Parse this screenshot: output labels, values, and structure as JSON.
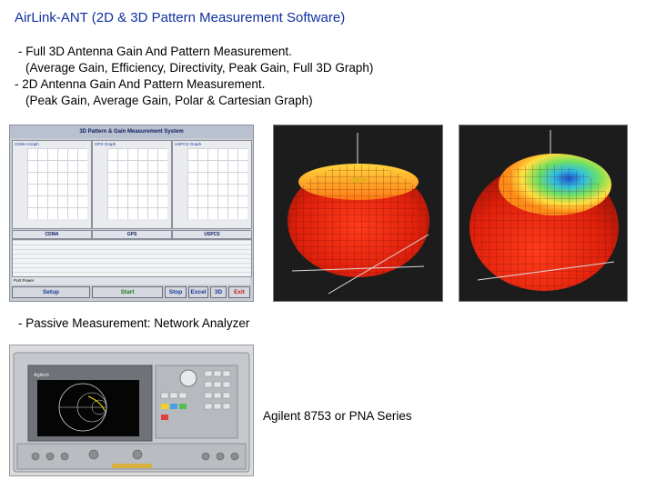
{
  "title": "AirLink-ANT (2D & 3D Pattern Measurement Software)",
  "bullets": [
    "- Full 3D Antenna Gain And Pattern Measurement.",
    "(Average Gain, Efficiency, Directivity, Peak Gain, Full 3D Graph)",
    "- 2D Antenna Gain And Pattern Measurement.",
    "(Peak Gain, Average Gain, Polar & Cartesian Graph)"
  ],
  "software": {
    "header": "3D Pattern & Gain Measurement System",
    "graphs": [
      "CDMA Graph",
      "GPS Graph",
      "USPCS Graph"
    ],
    "bands": [
      "CDMA",
      "GPS",
      "USPCS"
    ],
    "control_label": "Port Power",
    "buttons": [
      "Setup",
      "Start",
      "Stop",
      "Excel",
      "3D",
      "Exit"
    ]
  },
  "passive": "-  Passive Measurement: Network Analyzer",
  "analyzer_brand": "Agilent",
  "caption": "Agilent 8753 or PNA Series",
  "colors": {
    "title": "#1030a0"
  }
}
